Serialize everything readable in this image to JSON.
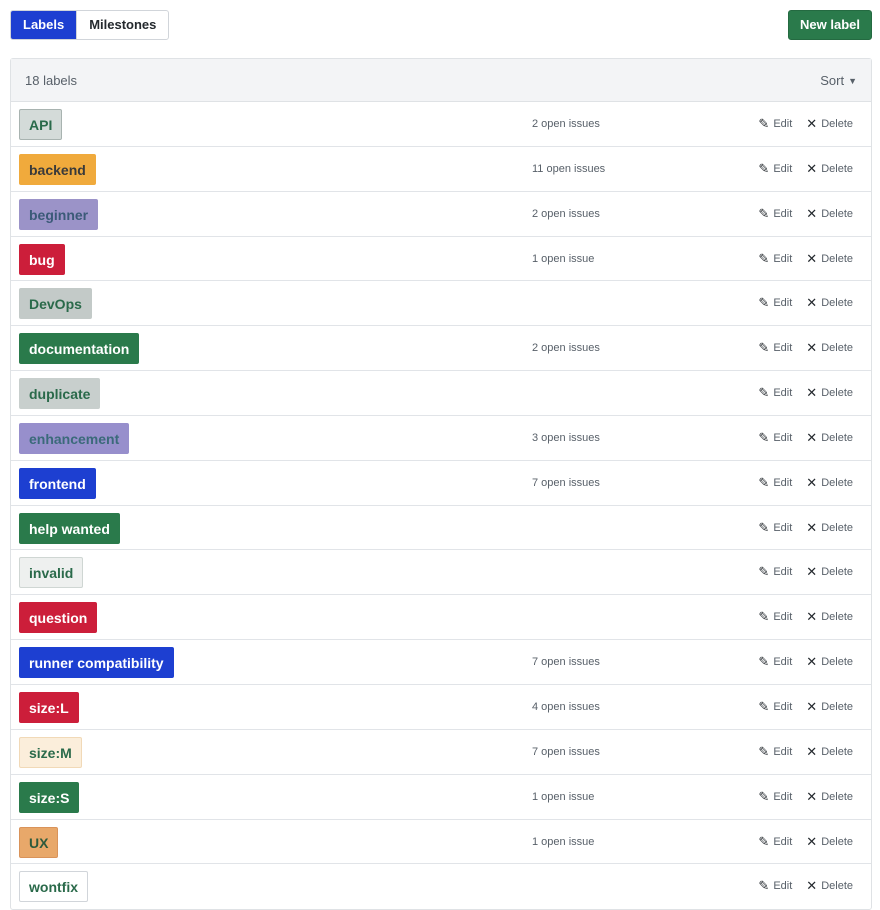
{
  "nav": {
    "tabs": [
      {
        "label": "Labels",
        "active": true
      },
      {
        "label": "Milestones",
        "active": false
      }
    ],
    "new_label": "New label"
  },
  "header": {
    "count": "18 labels",
    "sort": "Sort"
  },
  "actions": {
    "edit": "Edit",
    "delete": "Delete"
  },
  "labels": [
    {
      "name": "API",
      "issues": "2 open issues",
      "bg": "#d4dbd9",
      "fg": "#2a6a4a",
      "border": "#a8b3b0"
    },
    {
      "name": "backend",
      "issues": "11 open issues",
      "bg": "#f0aa3c",
      "fg": "#3a3a3a",
      "border": "#f0aa3c"
    },
    {
      "name": "beginner",
      "issues": "2 open issues",
      "bg": "#9b93c8",
      "fg": "#3b5a78",
      "border": "#9b93c8"
    },
    {
      "name": "bug",
      "issues": "1 open issue",
      "bg": "#cc1e3a",
      "fg": "#ffffff",
      "border": "#cc1e3a"
    },
    {
      "name": "DevOps",
      "issues": "",
      "bg": "#c3cac8",
      "fg": "#2a6a4a",
      "border": "#c3cac8"
    },
    {
      "name": "documentation",
      "issues": "2 open issues",
      "bg": "#2a7a4b",
      "fg": "#ffffff",
      "border": "#2a7a4b"
    },
    {
      "name": "duplicate",
      "issues": "",
      "bg": "#c8cfcd",
      "fg": "#2a6a4a",
      "border": "#c8cfcd"
    },
    {
      "name": "enhancement",
      "issues": "3 open issues",
      "bg": "#978fcc",
      "fg": "#3b6a7a",
      "border": "#978fcc"
    },
    {
      "name": "frontend",
      "issues": "7 open issues",
      "bg": "#1d3fd1",
      "fg": "#ffffff",
      "border": "#1d3fd1"
    },
    {
      "name": "help wanted",
      "issues": "",
      "bg": "#2a7a4b",
      "fg": "#ffffff",
      "border": "#2a7a4b"
    },
    {
      "name": "invalid",
      "issues": "",
      "bg": "#eef0ef",
      "fg": "#2a6a4a",
      "border": "#cfd6d3"
    },
    {
      "name": "question",
      "issues": "",
      "bg": "#cc1e3a",
      "fg": "#ffffff",
      "border": "#cc1e3a"
    },
    {
      "name": "runner compatibility",
      "issues": "7 open issues",
      "bg": "#1d3fd1",
      "fg": "#ffffff",
      "border": "#1d3fd1"
    },
    {
      "name": "size:L",
      "issues": "4 open issues",
      "bg": "#cc1e3a",
      "fg": "#ffffff",
      "border": "#cc1e3a"
    },
    {
      "name": "size:M",
      "issues": "7 open issues",
      "bg": "#fbeedb",
      "fg": "#2a6a4a",
      "border": "#f1d9b7"
    },
    {
      "name": "size:S",
      "issues": "1 open issue",
      "bg": "#2a7a4b",
      "fg": "#ffffff",
      "border": "#2a7a4b"
    },
    {
      "name": "UX",
      "issues": "1 open issue",
      "bg": "#e8a86a",
      "fg": "#2d5a3c",
      "border": "#d9935a"
    },
    {
      "name": "wontfix",
      "issues": "",
      "bg": "#ffffff",
      "fg": "#2a6a4a",
      "border": "#d1d5da"
    }
  ]
}
